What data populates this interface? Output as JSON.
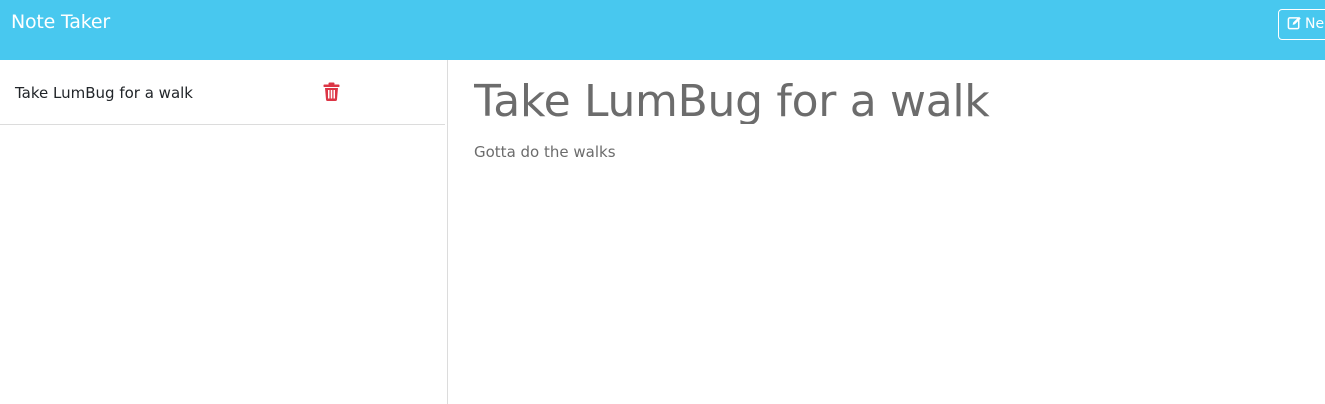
{
  "navbar": {
    "brand": "Note Taker",
    "new_note_label": "Ne",
    "new_note_icon": "edit-icon",
    "background_color": "#48c8ef"
  },
  "sidebar": {
    "notes": [
      {
        "title": "Take LumBug for a walk",
        "delete_icon": "trash-icon",
        "delete_color": "#dc3545"
      }
    ]
  },
  "editor": {
    "title": "Take LumBug for a walk",
    "text": "Gotta do the walks"
  }
}
